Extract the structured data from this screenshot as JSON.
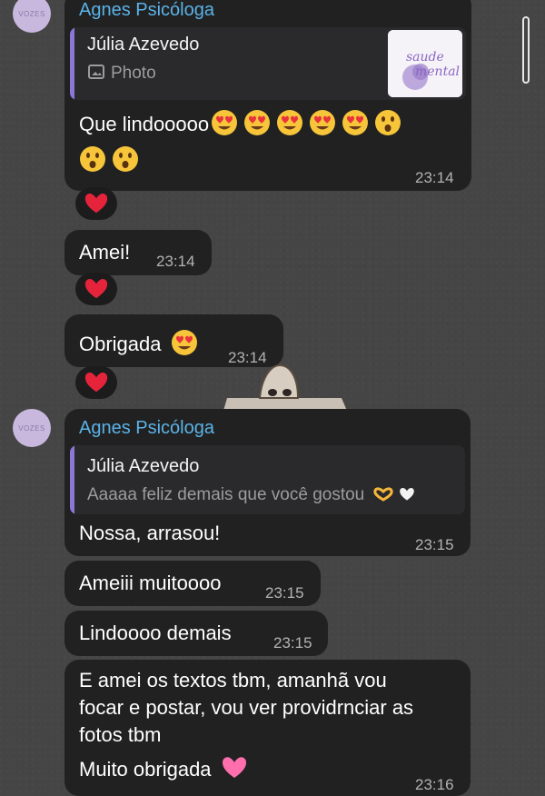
{
  "messages": [
    {
      "sender": "Agnes Psicóloga",
      "avatar_text": "VOZES",
      "reply": {
        "name": "Júlia Azevedo",
        "text": "Photo",
        "icon": "photo-icon"
      },
      "text_line1": "Que lindooooo",
      "time": "23:14",
      "reaction": "red-heart"
    },
    {
      "text": "Amei!",
      "time": "23:14",
      "reaction": "red-heart"
    },
    {
      "text": "Obrigada",
      "time": "23:14",
      "reaction": "red-heart"
    },
    {
      "sender": "Agnes Psicóloga",
      "avatar_text": "VOZES",
      "reply": {
        "name": "Júlia Azevedo",
        "text": "Aaaaa feliz demais que você gostou"
      },
      "text": "Nossa, arrasou!",
      "time": "23:15"
    },
    {
      "text": "Ameiii muitoooo",
      "time": "23:15"
    },
    {
      "text": "Lindoooo demais",
      "time": "23:15"
    },
    {
      "lines": [
        "E amei os textos tbm, amanhã vou",
        "focar e postar, vou ver providrnciar as",
        "fotos tbm"
      ],
      "last_line": "Muito obrigada",
      "time": "23:16"
    }
  ],
  "thumbnail_text": [
    "saude",
    "mental"
  ],
  "colors": {
    "sender": "#5ab3e8",
    "reply_bar": "#8b77d6",
    "bubble": "#212121"
  }
}
